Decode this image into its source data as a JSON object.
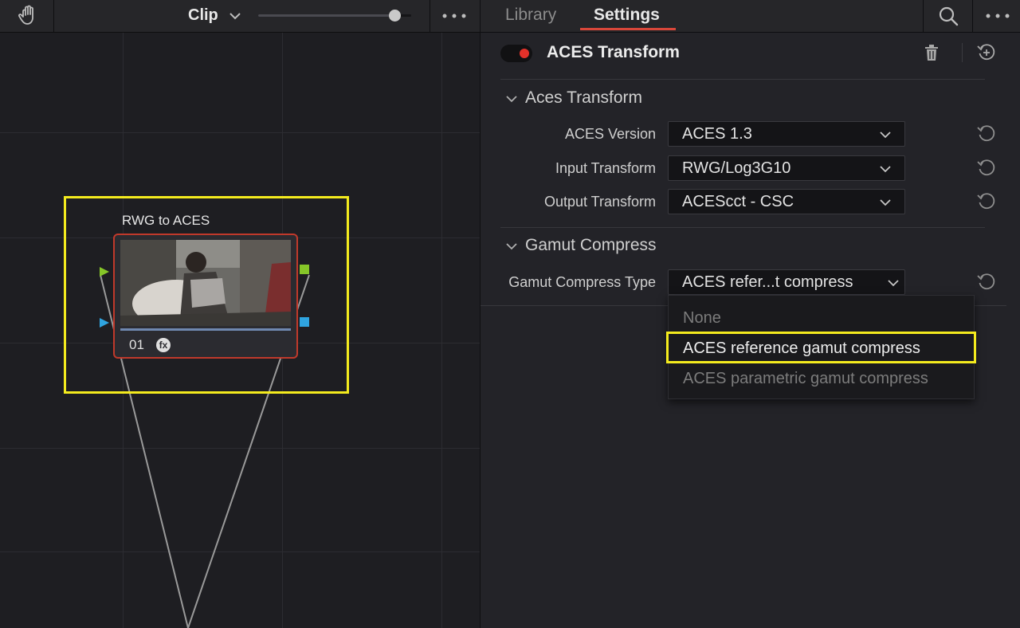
{
  "left_panel": {
    "toolbar": {
      "mode_label": "Clip",
      "zoom_percent": 89
    },
    "node": {
      "label": "RWG to ACES",
      "number": "01",
      "fx_badge": "fx"
    }
  },
  "right_panel": {
    "tabs": [
      {
        "label": "Library",
        "active": false
      },
      {
        "label": "Settings",
        "active": true
      }
    ],
    "effect": {
      "title": "ACES Transform",
      "enabled": true
    },
    "sections": {
      "aces_transform": {
        "title": "Aces Transform",
        "rows": [
          {
            "label": "ACES Version",
            "value": "ACES 1.3"
          },
          {
            "label": "Input Transform",
            "value": "RWG/Log3G10"
          },
          {
            "label": "Output Transform",
            "value": "ACEScct - CSC"
          }
        ]
      },
      "gamut_compress": {
        "title": "Gamut Compress",
        "row": {
          "label": "Gamut Compress Type",
          "value": "ACES refer...t compress"
        }
      }
    },
    "dropdown_menu": {
      "options": [
        {
          "label": "None",
          "state": "disabled"
        },
        {
          "label": "ACES reference gamut compress",
          "state": "highlighted"
        },
        {
          "label": "ACES parametric gamut compress",
          "state": "disabled"
        }
      ]
    }
  },
  "colors": {
    "accent": "#d9473a",
    "highlight": "#f4eb1e",
    "toggle_on": "#e2312a",
    "panel_bg": "#232328",
    "node_border": "#c0392b"
  },
  "icons": [
    "hand-icon",
    "chevron-down-icon",
    "more-dots-icon",
    "search-icon",
    "trash-icon",
    "reset-icon"
  ]
}
